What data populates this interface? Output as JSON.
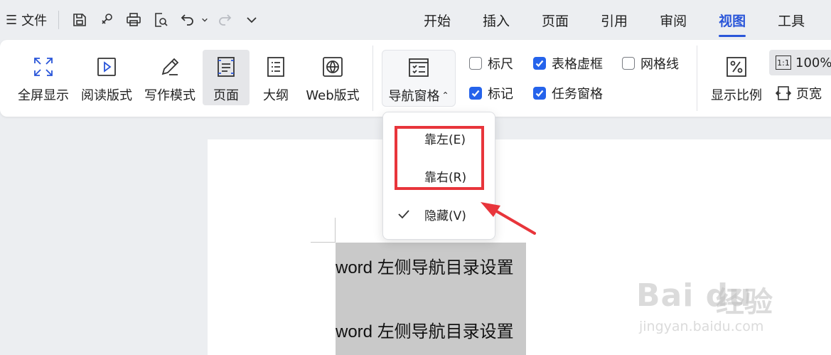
{
  "topbar": {
    "menu_glyph": "☰",
    "file_label": "文件",
    "quick_icons": [
      "save-icon",
      "link-icon",
      "print-icon",
      "print-preview-icon",
      "undo-icon",
      "redo-icon",
      "more-chevron-icon"
    ],
    "tabs": [
      {
        "label": "开始",
        "active": false
      },
      {
        "label": "插入",
        "active": false
      },
      {
        "label": "页面",
        "active": false
      },
      {
        "label": "引用",
        "active": false
      },
      {
        "label": "审阅",
        "active": false
      },
      {
        "label": "视图",
        "active": true
      },
      {
        "label": "工具",
        "active": false
      }
    ]
  },
  "ribbon": {
    "buttons": [
      {
        "label": "全屏显示",
        "icon": "fullscreen-icon",
        "selected": false
      },
      {
        "label": "阅读版式",
        "icon": "read-mode-icon",
        "selected": false
      },
      {
        "label": "写作模式",
        "icon": "pen-icon",
        "selected": false
      },
      {
        "label": "页面",
        "icon": "page-view-icon",
        "selected": true
      },
      {
        "label": "大纲",
        "icon": "outline-icon",
        "selected": false
      },
      {
        "label": "Web版式",
        "icon": "globe-icon",
        "selected": false
      }
    ],
    "nav_pane": {
      "label": "导航窗格",
      "caret": "⌃",
      "icon": "nav-pane-icon"
    },
    "checkboxes": [
      {
        "label": "标尺",
        "checked": false
      },
      {
        "label": "表格虚框",
        "checked": true
      },
      {
        "label": "网格线",
        "checked": false
      },
      {
        "label": "标记",
        "checked": true
      },
      {
        "label": "任务窗格",
        "checked": true
      }
    ],
    "zoom": {
      "label": "显示比例",
      "icon": "percent-icon",
      "value": "100%",
      "icon_text": "1:1"
    },
    "page_width": {
      "label": "页宽",
      "icon": "page-width-icon"
    }
  },
  "dropdown": {
    "items": [
      {
        "label": "靠左(E)",
        "checked": false
      },
      {
        "label": "靠右(R)",
        "checked": false
      },
      {
        "label": "隐藏(V)",
        "checked": true
      }
    ]
  },
  "document": {
    "lines": [
      "word 左侧导航目录设置",
      "word 左侧导航目录设置"
    ]
  },
  "watermark": {
    "logo": "Bai du",
    "cn": "经验",
    "url": "jingyan.baidu.com"
  },
  "colors": {
    "accent": "#2955d9",
    "checkbox": "#2563eb",
    "highlight": "#e8353b",
    "selection": "#c9c9c9"
  }
}
